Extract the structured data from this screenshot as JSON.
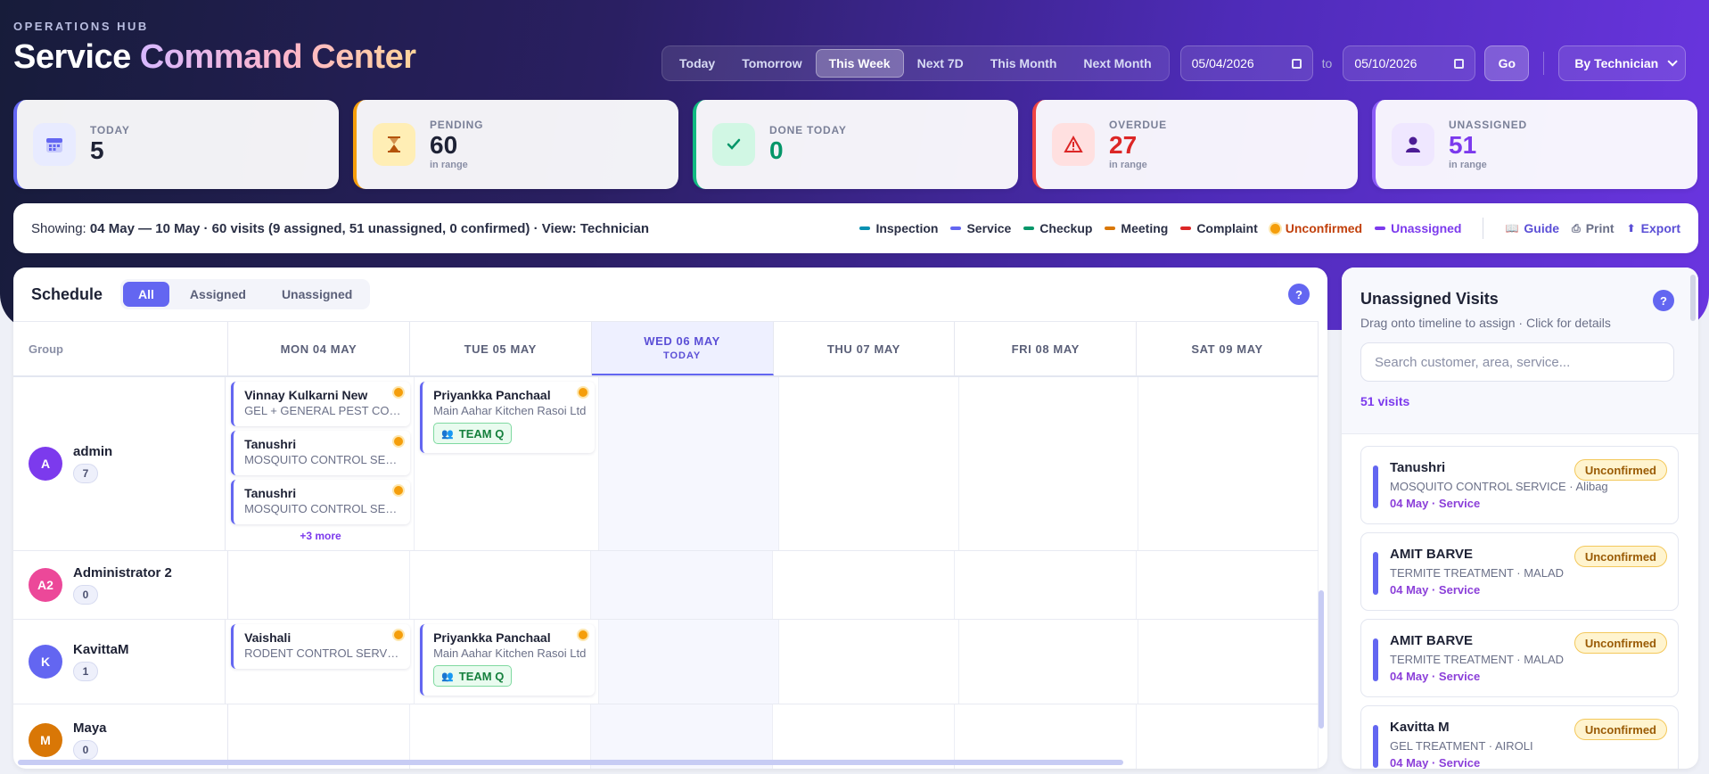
{
  "header": {
    "eyebrow": "OPERATIONS HUB",
    "title_main": "Service",
    "title_accent": "Command Center"
  },
  "toolbar": {
    "range_buttons": [
      "Today",
      "Tomorrow",
      "This Week",
      "Next 7D",
      "This Month",
      "Next Month"
    ],
    "active_range": "This Week",
    "date_from": "05/04/2026",
    "to_label": "to",
    "date_to": "05/10/2026",
    "go_label": "Go",
    "view_select": "By Technician"
  },
  "stats": [
    {
      "label": "TODAY",
      "value": "5",
      "sub": "",
      "icon": "calendar-icon",
      "color": "#6366f1",
      "value_color": "#1e2235"
    },
    {
      "label": "PENDING",
      "value": "60",
      "sub": "in range",
      "icon": "hourglass-icon",
      "color": "#f59e0b",
      "value_color": "#1e2235"
    },
    {
      "label": "DONE TODAY",
      "value": "0",
      "sub": "",
      "icon": "check-icon",
      "color": "#10b981",
      "value_color": "#059669"
    },
    {
      "label": "OVERDUE",
      "value": "27",
      "sub": "in range",
      "icon": "warning-icon",
      "color": "#ef4444",
      "value_color": "#dc2626"
    },
    {
      "label": "UNASSIGNED",
      "value": "51",
      "sub": "in range",
      "icon": "user-icon",
      "color": "#8b5cf6",
      "value_color": "#7c3aed"
    }
  ],
  "infobar": {
    "showing_prefix": "Showing:",
    "showing_text": "04 May — 10 May · 60 visits (9 assigned, 51 unassigned, 0 confirmed) · View: Technician",
    "legend": [
      {
        "label": "Inspection",
        "color": "#0891b2",
        "shape": "dash"
      },
      {
        "label": "Service",
        "color": "#6366f1",
        "shape": "dash"
      },
      {
        "label": "Checkup",
        "color": "#059669",
        "shape": "dash"
      },
      {
        "label": "Meeting",
        "color": "#d97706",
        "shape": "dash"
      },
      {
        "label": "Complaint",
        "color": "#dc2626",
        "shape": "dash"
      },
      {
        "label": "Unconfirmed",
        "color": "#c2410c",
        "shape": "dot"
      },
      {
        "label": "Unassigned",
        "color": "#7c3aed",
        "shape": "dash"
      }
    ],
    "actions": [
      {
        "label": "Guide",
        "icon": "book-icon"
      },
      {
        "label": "Print",
        "icon": "printer-icon"
      },
      {
        "label": "Export",
        "icon": "export-icon"
      }
    ]
  },
  "schedule": {
    "title": "Schedule",
    "filters": [
      "All",
      "Assigned",
      "Unassigned"
    ],
    "active_filter": "All",
    "help": "?",
    "group_header": "Group",
    "days": [
      {
        "label": "MON 04 MAY",
        "today": false
      },
      {
        "label": "TUE 05 MAY",
        "today": false
      },
      {
        "label": "WED 06 MAY",
        "today": true,
        "sub": "TODAY"
      },
      {
        "label": "THU 07 MAY",
        "today": false
      },
      {
        "label": "FRI 08 MAY",
        "today": false
      },
      {
        "label": "SAT 09 MAY",
        "today": false
      }
    ],
    "rows": [
      {
        "name": "admin",
        "initials": "A",
        "count": "7",
        "avatar_color": "#7c3aed",
        "height": 195,
        "cells": [
          {
            "cards": [
              {
                "name": "Vinnay Kulkarni New",
                "sub": "GEL + GENERAL PEST CONTROL"
              },
              {
                "name": "Tanushri",
                "sub": "MOSQUITO CONTROL SERVICE"
              },
              {
                "name": "Tanushri",
                "sub": "MOSQUITO CONTROL SERVICE"
              }
            ],
            "more": "+3 more"
          },
          {
            "cards": [
              {
                "name": "Priyankka Panchaal",
                "sub": "Main Aahar Kitchen Rasoi Ltd",
                "team": "TEAM Q"
              }
            ]
          },
          {
            "cards": []
          },
          {
            "cards": []
          },
          {
            "cards": []
          },
          {
            "cards": []
          }
        ]
      },
      {
        "name": "Administrator 2",
        "initials": "A2",
        "count": "0",
        "avatar_color": "#ec4899",
        "height": 77,
        "cells": [
          {
            "cards": []
          },
          {
            "cards": []
          },
          {
            "cards": []
          },
          {
            "cards": []
          },
          {
            "cards": []
          },
          {
            "cards": []
          }
        ]
      },
      {
        "name": "KavittaM",
        "initials": "K",
        "count": "1",
        "avatar_color": "#6366f1",
        "height": 95,
        "cells": [
          {
            "cards": [
              {
                "name": "Vaishali",
                "sub": "RODENT CONTROL SERVICE"
              }
            ]
          },
          {
            "cards": [
              {
                "name": "Priyankka Panchaal",
                "sub": "Main Aahar Kitchen Rasoi Ltd",
                "team": "TEAM Q"
              }
            ]
          },
          {
            "cards": []
          },
          {
            "cards": []
          },
          {
            "cards": []
          },
          {
            "cards": []
          }
        ]
      },
      {
        "name": "Maya",
        "initials": "M",
        "count": "0",
        "avatar_color": "#d97706",
        "height": 80,
        "cells": [
          {
            "cards": []
          },
          {
            "cards": []
          },
          {
            "cards": []
          },
          {
            "cards": []
          },
          {
            "cards": []
          },
          {
            "cards": []
          }
        ]
      }
    ]
  },
  "unassigned_panel": {
    "title": "Unassigned Visits",
    "help": "?",
    "subtitle": "Drag onto timeline to assign · Click for details",
    "search_placeholder": "Search customer, area, service...",
    "count_text": "51 visits",
    "items": [
      {
        "name": "Tanushri",
        "detail": "MOSQUITO CONTROL SERVICE · Alibag",
        "meta": "04 May · Service",
        "badge": "Unconfirmed"
      },
      {
        "name": "AMIT BARVE",
        "detail": "TERMITE TREATMENT · MALAD",
        "meta": "04 May · Service",
        "badge": "Unconfirmed"
      },
      {
        "name": "AMIT BARVE",
        "detail": "TERMITE TREATMENT · MALAD",
        "meta": "04 May · Service",
        "badge": "Unconfirmed"
      },
      {
        "name": "Kavitta M",
        "detail": "GEL TREATMENT · AIROLI",
        "meta": "04 May · Service",
        "badge": "Unconfirmed"
      }
    ]
  }
}
